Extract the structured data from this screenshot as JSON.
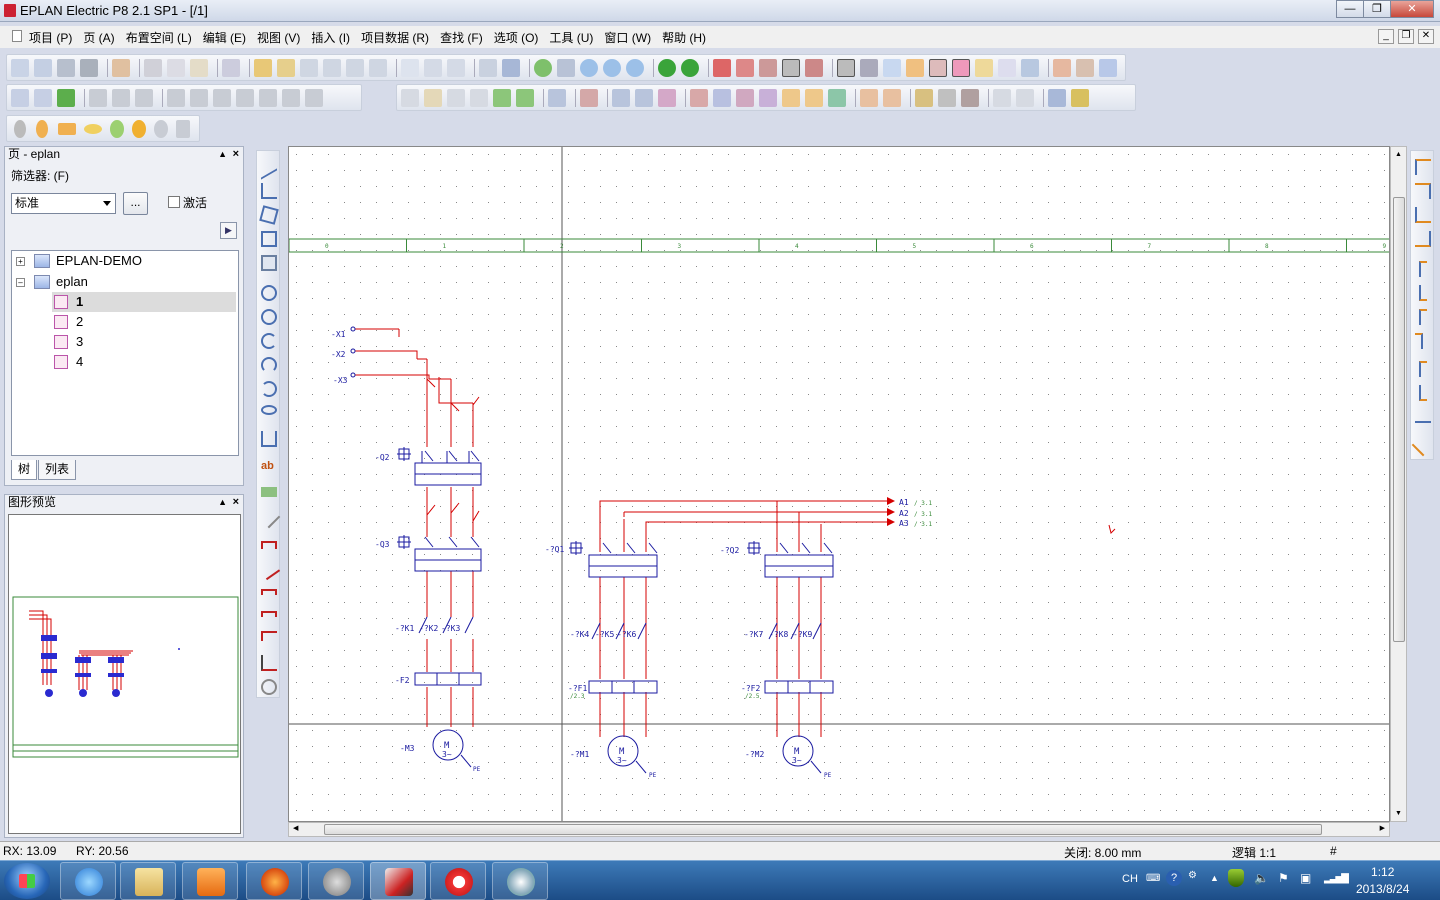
{
  "window": {
    "title": "EPLAN Electric P8 2.1 SP1 - [/1]"
  },
  "menu": [
    "项目 (P)",
    "页 (A)",
    "布置空间 (L)",
    "编辑 (E)",
    "视图 (V)",
    "插入 (I)",
    "项目数据 (R)",
    "查找 (F)",
    "选项 (O)",
    "工具 (U)",
    "窗口 (W)",
    "帮助 (H)"
  ],
  "page_panel": {
    "title": "页 - eplan",
    "filter_label": "筛选器: (F)",
    "filter_value": "标准",
    "ellipsis": "...",
    "activate_label": "激活",
    "tree": {
      "root1": "EPLAN-DEMO",
      "root2": "eplan",
      "pages": [
        "1",
        "2",
        "3",
        "4"
      ]
    },
    "tabs": [
      "树",
      "列表"
    ]
  },
  "preview_panel": {
    "title": "图形预览"
  },
  "schematic": {
    "column_numbers": [
      "0",
      "1",
      "2",
      "3",
      "4",
      "5",
      "6",
      "7",
      "8",
      "9"
    ],
    "terminals": [
      "-X1",
      "-X2",
      "-X3"
    ],
    "devices": [
      "-Q2",
      "-Q3",
      "-?K1",
      "-?K2",
      "-?K3",
      "-F2",
      "-M3",
      "-?Q1",
      "-?Q2",
      "-?K4",
      "-?K5",
      "-?K6",
      "-?K7",
      "-?K8",
      "-?K9",
      "-?F1",
      "-?F2",
      "-?M1",
      "-?M2"
    ],
    "refs": [
      "/2.3",
      "/2.5"
    ],
    "arrows": [
      "A1",
      "A2",
      "A3"
    ],
    "arrow_refs": [
      "/ 3.1",
      "/ 3.1",
      "/ 3.1"
    ],
    "motor_label": "M",
    "motor_phase": "3~",
    "pe": "PE",
    "colors": {
      "wire": "#d40000",
      "device": "#1a1aa0",
      "grid": "#3a8a3a"
    }
  },
  "status": {
    "rx": "RX: 13.09",
    "ry": "RY: 20.56",
    "grid": "关闭: 8.00 mm",
    "logic": "逻辑 1:1",
    "hash": "#"
  },
  "taskbar": {
    "lang": "CH",
    "time": "1:12",
    "date": "2013/8/24"
  }
}
